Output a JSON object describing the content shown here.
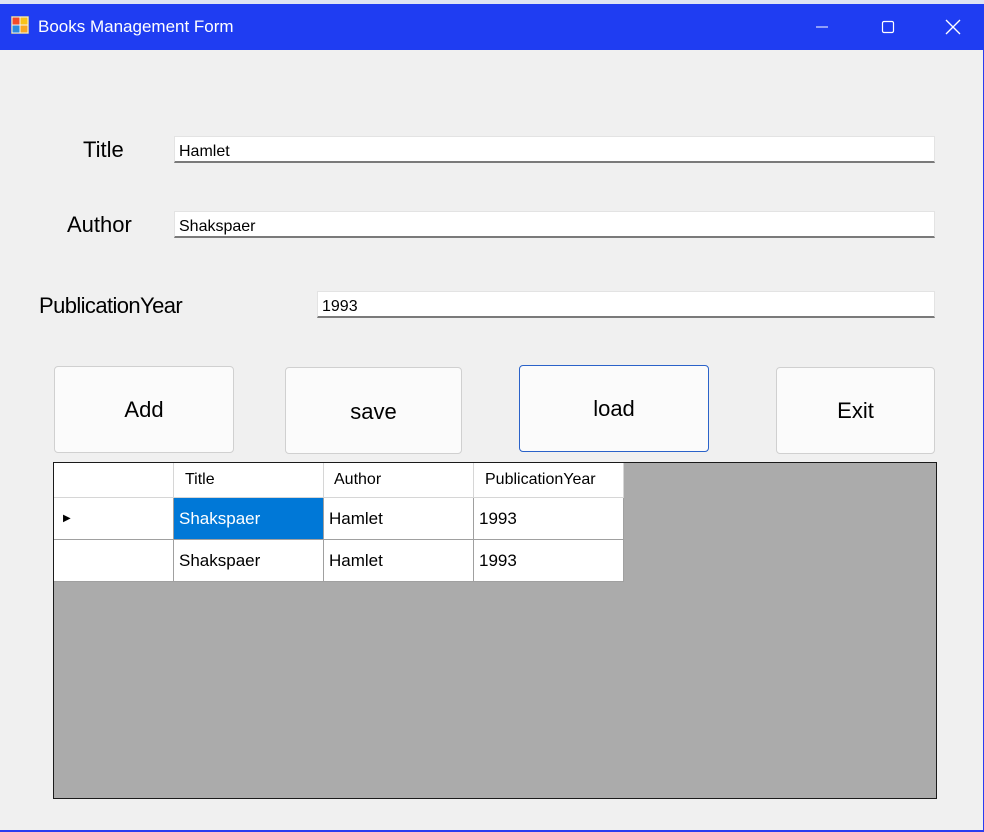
{
  "window": {
    "title": "Books Management Form"
  },
  "form": {
    "title_label": "Title",
    "title_value": "Hamlet",
    "author_label": "Author",
    "author_value": "Shakspaer",
    "year_label": "PublicationYear",
    "year_value": "1993"
  },
  "buttons": {
    "add": "Add",
    "save": "save",
    "load": "load",
    "exit": "Exit"
  },
  "grid": {
    "columns": [
      "Title",
      "Author",
      "PublicationYear"
    ],
    "rows": [
      {
        "title": "Shakspaer",
        "author": "Hamlet",
        "year": "1993",
        "current": true
      },
      {
        "title": "Shakspaer",
        "author": "Hamlet",
        "year": "1993",
        "current": false
      }
    ],
    "current_row_glyph": "▶"
  },
  "colors": {
    "titlebar": "#1f3df2",
    "selection": "#0078d7",
    "grid_background": "#ababab",
    "focus_border": "#2a62c9"
  }
}
